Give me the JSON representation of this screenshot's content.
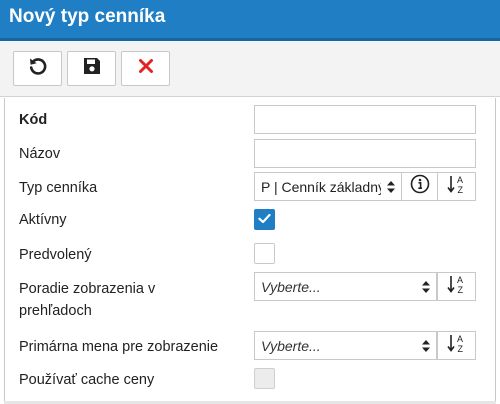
{
  "window": {
    "title": "Nový typ cenníka"
  },
  "toolbar": {
    "buttons": [
      {
        "icon": "undo-icon"
      },
      {
        "icon": "save-icon"
      },
      {
        "icon": "close-icon",
        "color": "#e02424"
      }
    ]
  },
  "form": {
    "kod": {
      "label": "Kód",
      "value": ""
    },
    "nazov": {
      "label": "Názov",
      "value": ""
    },
    "typ_cennika": {
      "label": "Typ cenníka",
      "value": "P | Cenník základný"
    },
    "aktivny": {
      "label": "Aktívny",
      "checked": true
    },
    "predvoleny": {
      "label": "Predvolený",
      "checked": false
    },
    "poradie": {
      "label_line1": "Poradie zobrazenia v",
      "label_line2": "prehľadoch",
      "placeholder": "Vyberte..."
    },
    "primarna_mena": {
      "label": "Primárna mena pre zobrazenie",
      "placeholder": "Vyberte..."
    },
    "cache": {
      "label": "Používať cache ceny",
      "checked": false,
      "disabled": true
    }
  },
  "colors": {
    "accent": "#1f7ec4",
    "danger": "#e02424"
  }
}
